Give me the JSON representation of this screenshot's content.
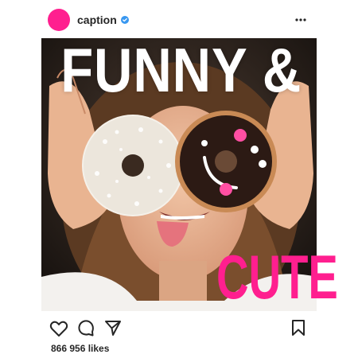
{
  "header": {
    "username": "caption",
    "avatar_color": "#ff1f8f",
    "verified_color": "#3897f0",
    "more_icon": "more-horizontal-icon"
  },
  "post": {
    "headline_top": "FUNNY &",
    "headline_bottom": "CUTE",
    "accent_color": "#ff1f8f"
  },
  "actions": {
    "like_icon": "heart-icon",
    "comment_icon": "comment-icon",
    "share_icon": "send-icon",
    "bookmark_icon": "bookmark-icon"
  },
  "likes": {
    "text": "866 956 likes"
  }
}
